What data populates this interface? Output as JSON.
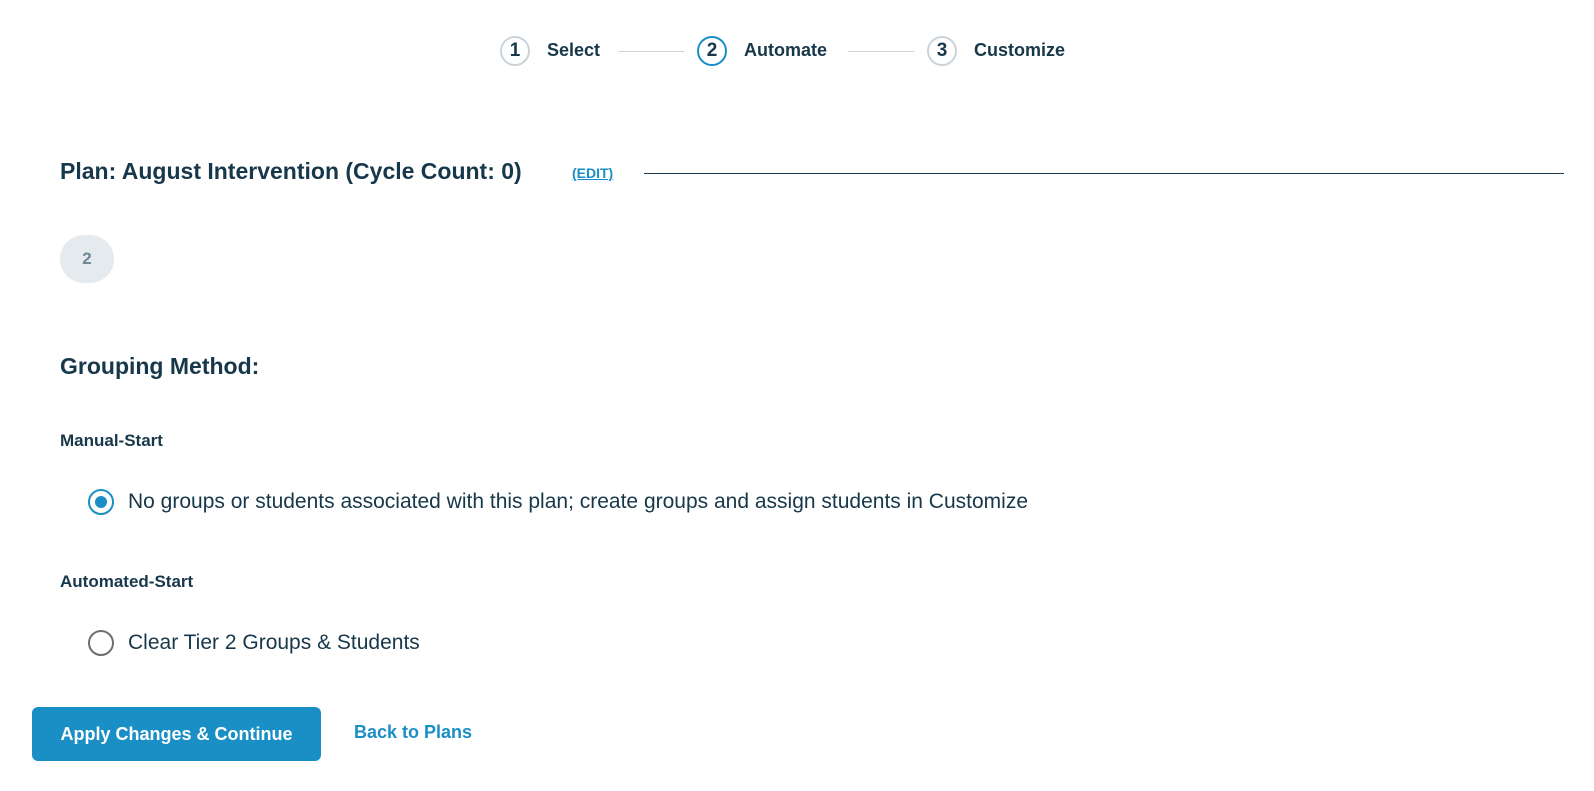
{
  "stepper": {
    "steps": [
      {
        "number": "1",
        "label": "Select",
        "state": "complete"
      },
      {
        "number": "2",
        "label": "Automate",
        "state": "active"
      },
      {
        "number": "3",
        "label": "Customize",
        "state": "upcoming"
      }
    ]
  },
  "plan": {
    "title": "Plan: August Intervention (Cycle Count: 0)",
    "edit_label": "(EDIT)"
  },
  "tier_badge": "2",
  "grouping": {
    "title": "Grouping Method:",
    "manual_heading": "Manual-Start",
    "manual_option": {
      "label": "No groups or students associated with this plan; create groups and assign students in Customize",
      "checked": true
    },
    "automated_heading": "Automated-Start",
    "automated_option": {
      "label": "Clear Tier 2 Groups & Students",
      "checked": false
    }
  },
  "actions": {
    "primary_label": "Apply Changes & Continue",
    "secondary_label": "Back to Plans"
  },
  "colors": {
    "accent": "#1a8fc6",
    "text": "#17374a",
    "badge_bg": "#e4eaed"
  }
}
